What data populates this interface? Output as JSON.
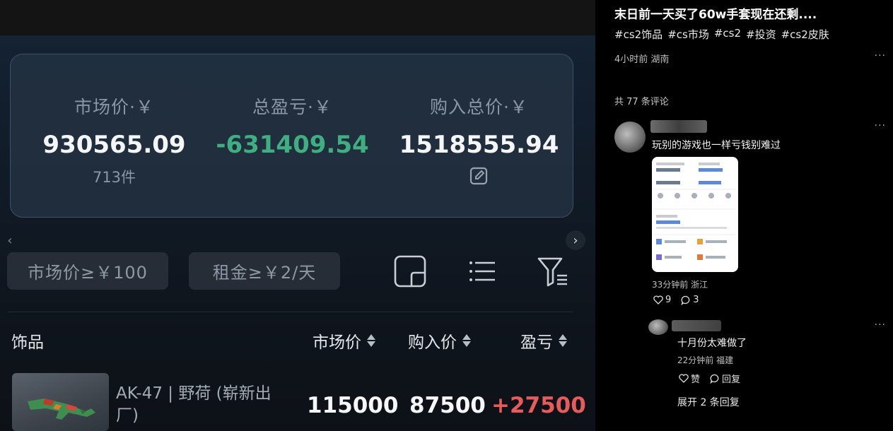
{
  "video": {
    "stats": {
      "market_label": "市场价·￥",
      "market_value": "930565.09",
      "item_count": "713件",
      "pnl_label": "总盈亏·￥",
      "pnl_value": "-631409.54",
      "cost_label": "购入总价·￥",
      "cost_value": "1518555.94"
    },
    "filters": {
      "price_chip": "市场价≥￥100",
      "rent_chip": "租金≥￥2/天"
    },
    "table": {
      "headers": {
        "item": "饰品",
        "market": "市场价",
        "buy": "购入价",
        "pnl": "盈亏"
      },
      "rows": [
        {
          "name": "AK-47 | 野荷 (崭新出厂)",
          "market": "115000",
          "buy": "87500",
          "pnl": "+27500"
        }
      ]
    },
    "colors": {
      "pnl_negative": "#3fae80",
      "pnl_positive": "#e85b5b"
    }
  },
  "post": {
    "title": "末日前一天买了60w手套现在还剩....",
    "hashtags": [
      "#cs2饰品",
      "#cs市场",
      "#cs2",
      "#投资",
      "#cs2皮肤"
    ],
    "meta": "4小时前 湖南"
  },
  "comments": {
    "count_label": "共 77 条评论",
    "items": [
      {
        "text": "玩别的游戏也一样亏钱别难过",
        "meta": "33分钟前 浙江",
        "likes": "9",
        "replies": "3"
      },
      {
        "text": "十月份太难做了",
        "meta": "22分钟前 福建",
        "like_label": "赞",
        "reply_label": "回复"
      }
    ],
    "expand_label": "展开 2 条回复"
  }
}
